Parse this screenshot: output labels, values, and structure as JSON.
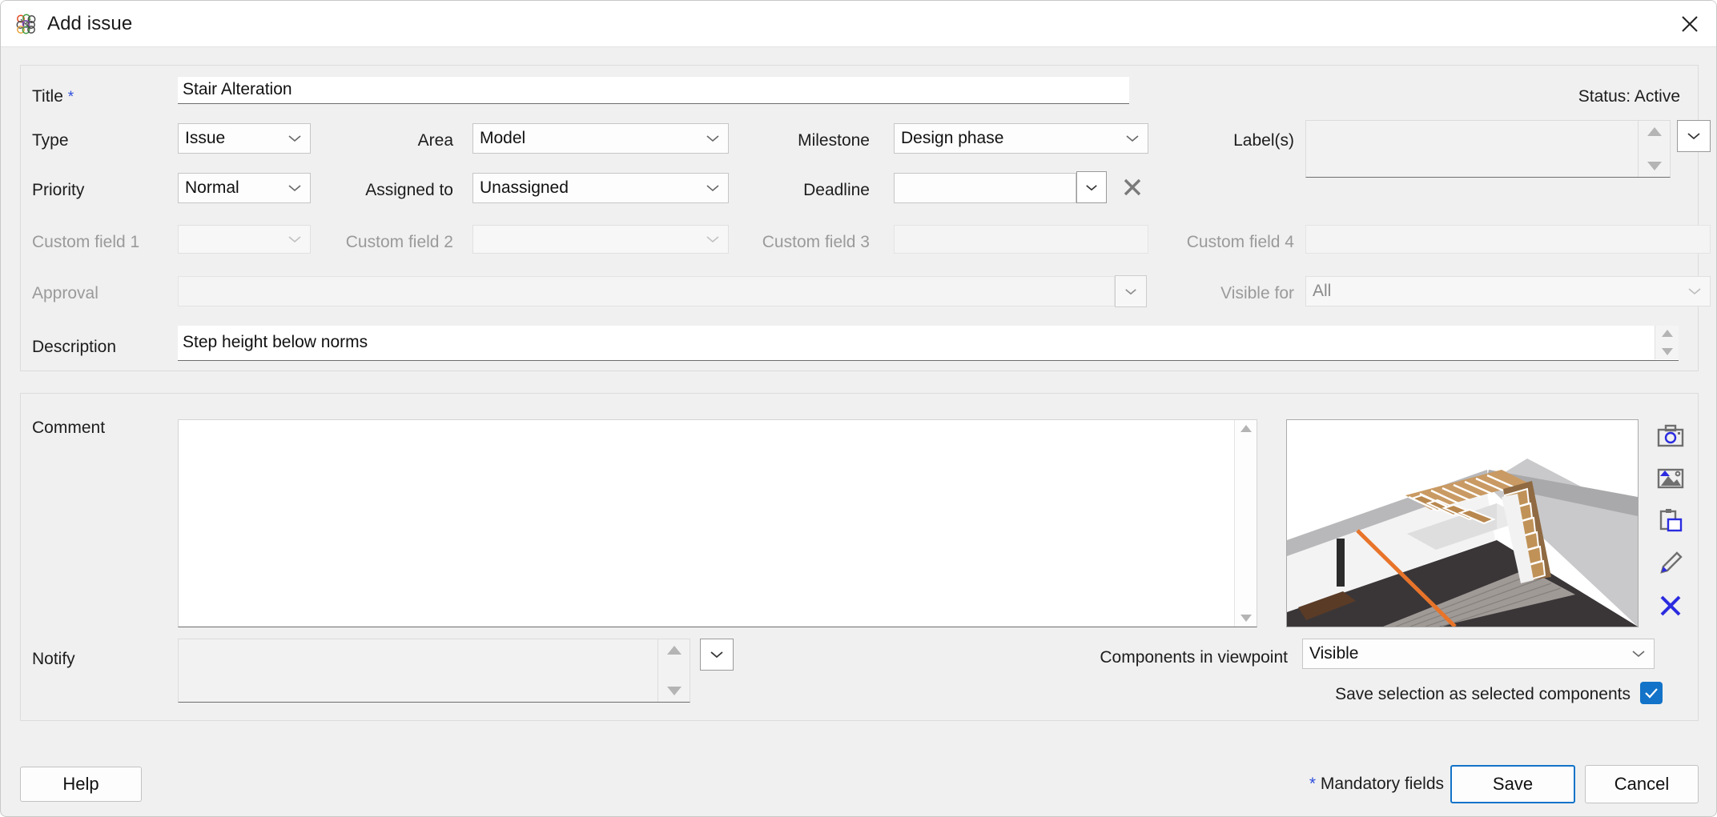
{
  "window": {
    "title": "Add issue",
    "app_icon": "bimcollab-dots-icon",
    "close_icon": "close-icon"
  },
  "status": {
    "text": "Status: Active"
  },
  "fields": {
    "title": {
      "label": "Title",
      "required_marker": "*",
      "value": "Stair Alteration"
    },
    "type": {
      "label": "Type",
      "value": "Issue"
    },
    "area": {
      "label": "Area",
      "value": "Model"
    },
    "milestone": {
      "label": "Milestone",
      "value": "Design phase"
    },
    "labels": {
      "label": "Label(s)",
      "value": ""
    },
    "priority": {
      "label": "Priority",
      "value": "Normal"
    },
    "assigned_to": {
      "label": "Assigned to",
      "value": "Unassigned"
    },
    "deadline": {
      "label": "Deadline",
      "value": "",
      "clear_icon": "clear-x-icon"
    },
    "custom_field_1": {
      "label": "Custom field 1",
      "value": ""
    },
    "custom_field_2": {
      "label": "Custom field 2",
      "value": ""
    },
    "custom_field_3": {
      "label": "Custom field 3",
      "value": ""
    },
    "custom_field_4": {
      "label": "Custom field 4",
      "value": ""
    },
    "approval": {
      "label": "Approval",
      "value": ""
    },
    "visible_for": {
      "label": "Visible for",
      "value": "All"
    },
    "description": {
      "label": "Description",
      "value": "Step height below norms"
    },
    "comment": {
      "label": "Comment",
      "value": ""
    },
    "notify": {
      "label": "Notify",
      "value": ""
    },
    "components_in_viewpoint": {
      "label": "Components in viewpoint",
      "value": "Visible"
    },
    "save_selection": {
      "label": "Save selection as selected components",
      "checked": true
    }
  },
  "viewpoint": {
    "tools": [
      {
        "name": "camera-icon",
        "label": "Take snapshot"
      },
      {
        "name": "image-icon",
        "label": "Select image"
      },
      {
        "name": "paste-icon",
        "label": "Paste image"
      },
      {
        "name": "pencil-icon",
        "label": "Edit image"
      },
      {
        "name": "delete-x-icon",
        "label": "Delete image"
      }
    ]
  },
  "footer": {
    "help": "Help",
    "mandatory_star": "*",
    "mandatory_note": "Mandatory fields",
    "save": "Save",
    "cancel": "Cancel"
  },
  "colors": {
    "accent_blue": "#1273c8",
    "required_blue": "#2f4fdd",
    "panel_bg": "#f0f0f0",
    "titlebar_bg": "#ffffff"
  }
}
